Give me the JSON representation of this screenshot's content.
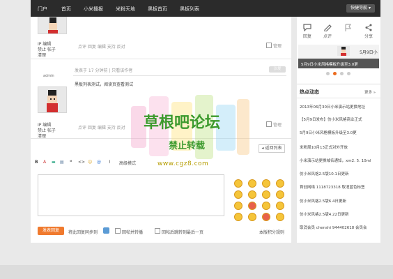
{
  "nav": {
    "items": [
      "门户",
      "首页",
      "小米播报",
      "米粉天地",
      "黑板首页",
      "黑板列表"
    ],
    "quick_nav": "快捷导航 ▾"
  },
  "post1": {
    "user_lines": [
      "IP 编辑",
      "禁止  帖子",
      "清理"
    ],
    "actions": "点评  回复    编辑  支持  反对",
    "manage": "管理"
  },
  "post2": {
    "username": "admin",
    "meta": "发表于  17 分钟前    |  只看该作者",
    "floor": "沙发",
    "content": "黑板列表测试，阅读页查看测试",
    "user_lines": [
      "IP 编辑",
      "禁止  帖子",
      "清理"
    ],
    "actions": "点评  回复    编辑  支持  反对",
    "manage": "管理"
  },
  "back_list": "返回列表",
  "editor": {
    "toolbar_icons": [
      "B",
      "A",
      "▬",
      "▤",
      "❝",
      "<>",
      "☺",
      "@",
      "⌇"
    ],
    "advanced": "高级模式",
    "submit": "发表回复",
    "sync_label": "将此回复同步到",
    "check1": "回帖并转播",
    "check2": "回帖后跳转到最后一页",
    "rules": "本版积分规则"
  },
  "side_actions": [
    {
      "label": "回复",
      "icon": "comment-icon"
    },
    {
      "label": "点评",
      "icon": "pen-icon"
    },
    {
      "label": "",
      "icon": "flag-icon"
    },
    {
      "label": "分享",
      "icon": "share-icon"
    }
  ],
  "slider": {
    "date": "5月9日小",
    "caption": "5月9日小米风格模板升级至3.0更",
    "dots": 4,
    "active_dot": 2
  },
  "hot": {
    "title": "热点动态",
    "more": "更多 »",
    "items": [
      {
        "text": "2013年06月30日小米演示站更换地址",
        "highlight": true
      },
      {
        "text": "【5月9日发布】仿小米风格商业正式",
        "highlight": true
      },
      {
        "text": "5月9日小米风格模板升级至3.0更",
        "highlight": true
      },
      {
        "text": "米粉周10月13正式对外开放",
        "highlight": false
      },
      {
        "text": "小米演示站更换域名通知，xm2. 5. 10ml",
        "highlight": false
      },
      {
        "text": "仿小米风格2.5版10.1日更新",
        "highlight": false
      },
      {
        "text": "首创网络 1118723318 取消蓝色标签",
        "highlight": false
      },
      {
        "text": "仿小米风格2.5版6.4日更新",
        "highlight": false
      },
      {
        "text": "仿小米风格2.5版4.22日更新",
        "highlight": false
      },
      {
        "text": "取消会员 chenshi  944402618 会员会",
        "highlight": false
      }
    ]
  },
  "watermark": {
    "title": "草根吧论坛",
    "subtitle": "禁止转载",
    "url": "www.cgz8.com"
  },
  "colors": {
    "accent": "#f07a2e",
    "nav_bg": "#2b2b2b",
    "watermark_green": "#3c9a2d"
  }
}
